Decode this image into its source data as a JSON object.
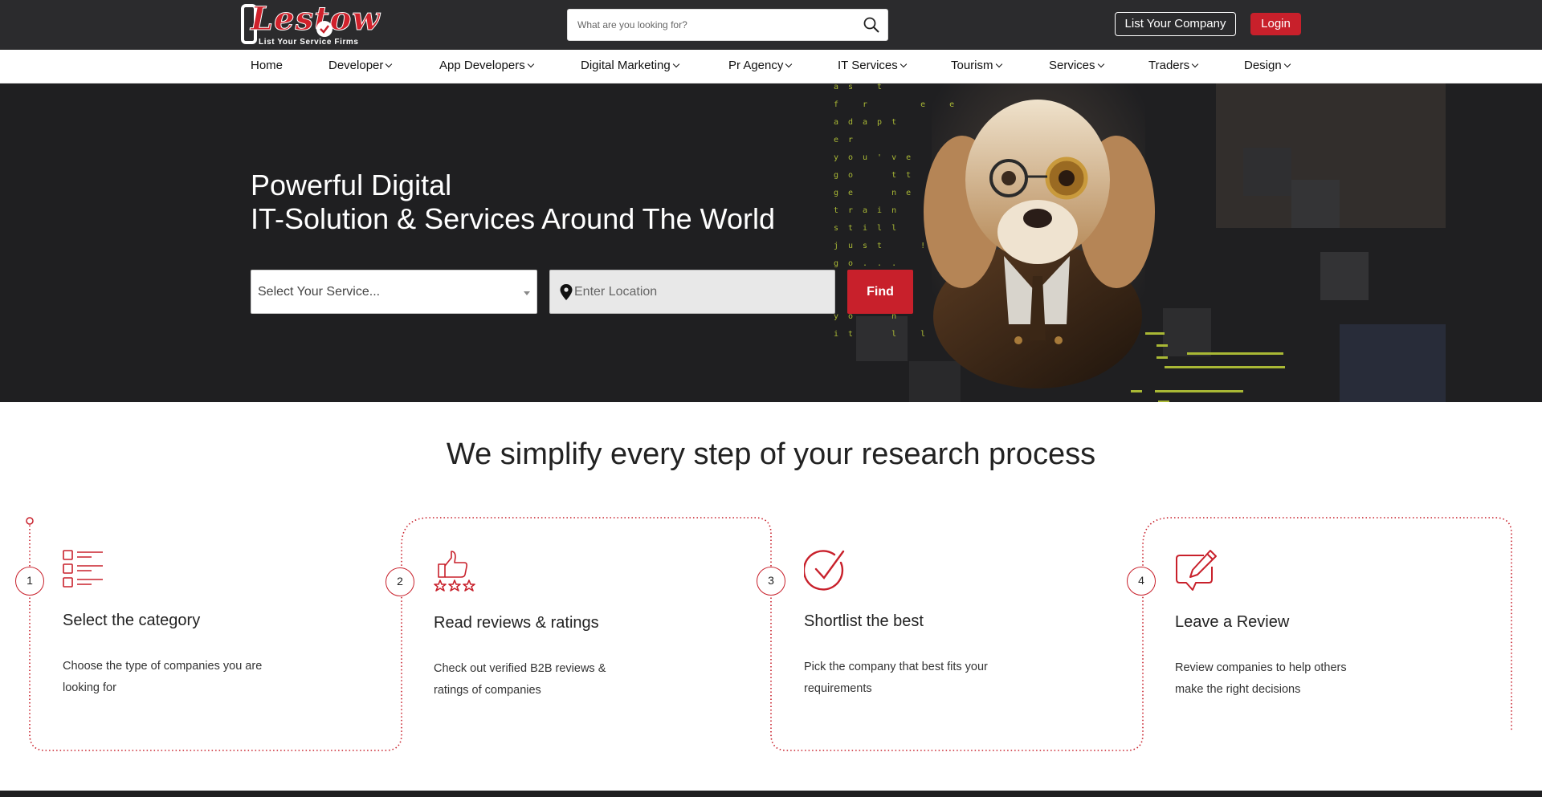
{
  "header": {
    "logo_text": "Lestow",
    "logo_tagline": "List Your Service Firms",
    "search_placeholder": "What are you looking for?",
    "list_company_label": "List Your Company",
    "login_label": "Login"
  },
  "nav": {
    "items": [
      {
        "label": "Home",
        "dropdown": false
      },
      {
        "label": "Developer",
        "dropdown": true
      },
      {
        "label": "App Developers",
        "dropdown": true
      },
      {
        "label": "Digital Marketing",
        "dropdown": true
      },
      {
        "label": "Pr Agency",
        "dropdown": true
      },
      {
        "label": "IT Services",
        "dropdown": true
      },
      {
        "label": "Tourism",
        "dropdown": true
      },
      {
        "label": "Services",
        "dropdown": true
      },
      {
        "label": "Traders",
        "dropdown": true
      },
      {
        "label": "Design",
        "dropdown": true
      }
    ]
  },
  "hero": {
    "title_line1": "Powerful Digital",
    "title_line2": "IT-Solution & Services Around The World",
    "service_select_value": "Select Your Service...",
    "location_placeholder": "Enter Location",
    "find_label": "Find",
    "code_lines": [
      "as t",
      "f r   e e",
      "adapt",
      "er",
      "you've",
      "go  tt",
      "ge  ne",
      "train",
      "still",
      "just  !",
      "go...",
      "",
      "",
      "yo  n",
      "it  l l"
    ]
  },
  "steps": {
    "title": "We simplify every step of your research process",
    "items": [
      {
        "number": "1",
        "icon": "checklist-icon",
        "title": "Select the category",
        "text": "Choose the type of companies you are looking for"
      },
      {
        "number": "2",
        "icon": "thumbs-up-stars-icon",
        "title": "Read reviews & ratings",
        "text": "Check out verified B2B reviews & ratings of companies"
      },
      {
        "number": "3",
        "icon": "checkmark-circle-icon",
        "title": "Shortlist the best",
        "text": "Pick the company that best fits your requirements"
      },
      {
        "number": "4",
        "icon": "review-edit-icon",
        "title": "Leave a Review",
        "text": "Review companies to help others make the right decisions"
      }
    ]
  },
  "colors": {
    "accent": "#c8202b",
    "topbar": "#2b2b2d",
    "hero_bg": "#1f1f21"
  }
}
